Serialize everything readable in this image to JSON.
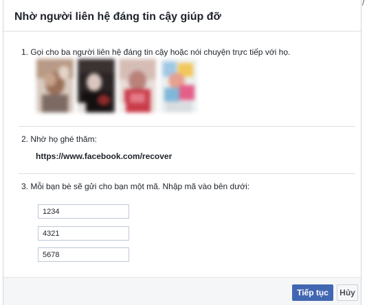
{
  "dialog": {
    "title": "Nhờ người liên hệ đáng tin cậy giúp đỡ",
    "step1": "1. Gọi cho ba người liên hệ đáng tin cậy hoặc nói chuyện trực tiếp với họ.",
    "step2": "2. Nhờ họ ghé thăm:",
    "recover_url": "https://www.facebook.com/recover",
    "step3": "3. Mỗi bạn bè sẽ gửi cho bạn một mã. Nhập mã vào bên dưới:",
    "codes": [
      "1234",
      "4321",
      "5678"
    ],
    "continue_label": "Tiếp tục",
    "cancel_label": "Hủy"
  },
  "colors": {
    "primary_button": "#4267b2",
    "footer_background": "#f5f6f7",
    "divider": "#dddfe2"
  }
}
